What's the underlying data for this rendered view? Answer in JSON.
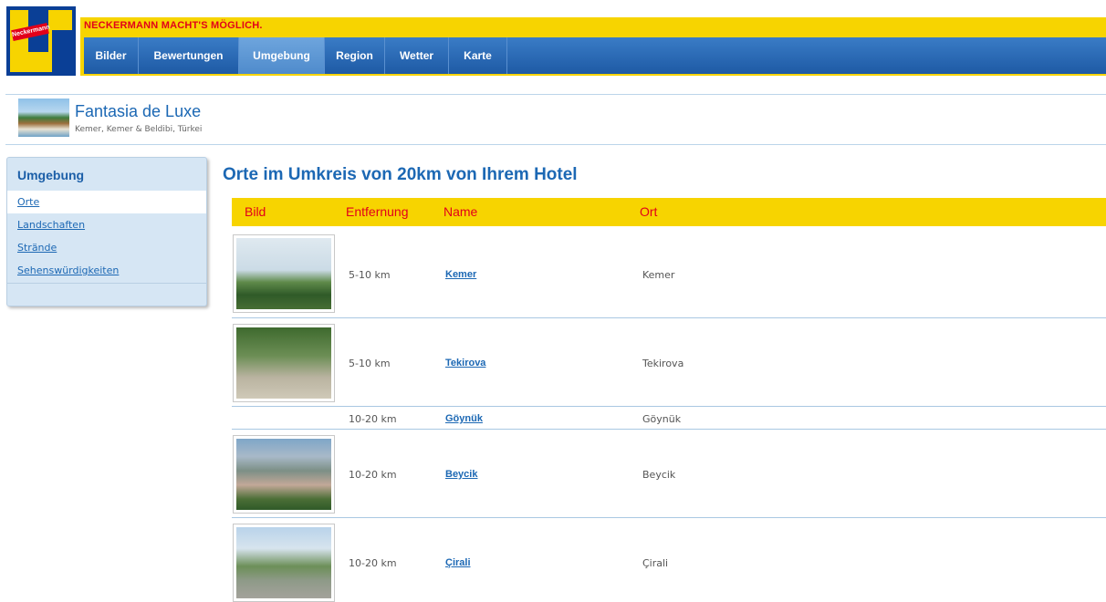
{
  "brand": {
    "logo_text": "Neckermann",
    "slogan": "NECKERMANN MACHT'S MÖGLICH.",
    "colors": {
      "yellow": "#f7d400",
      "blue": "#1e5aa5",
      "red": "#e2001a"
    }
  },
  "nav": {
    "items": [
      {
        "label": "Bilder",
        "active": false
      },
      {
        "label": "Bewertungen",
        "active": false
      },
      {
        "label": "Umgebung",
        "active": true
      },
      {
        "label": "Region",
        "active": false
      },
      {
        "label": "Wetter",
        "active": false
      },
      {
        "label": "Karte",
        "active": false
      }
    ]
  },
  "hotel": {
    "name": "Fantasia de Luxe",
    "location": "Kemer, Kemer & Beldibi, Türkei"
  },
  "sidebar": {
    "title": "Umgebung",
    "items": [
      {
        "label": "Orte",
        "active": true
      },
      {
        "label": "Landschaften",
        "active": false
      },
      {
        "label": "Strände",
        "active": false
      },
      {
        "label": "Sehenswürdigkeiten",
        "active": false
      }
    ]
  },
  "main": {
    "title": "Orte im Umkreis von 20km von Ihrem Hotel",
    "columns": [
      "Bild",
      "Entfernung",
      "Name",
      "Ort"
    ],
    "rows": [
      {
        "has_image": true,
        "image_icon": "minaret-photo",
        "distance": "5-10 km",
        "name": "Kemer",
        "ort": "Kemer"
      },
      {
        "has_image": true,
        "image_icon": "forest-path-photo",
        "distance": "5-10 km",
        "name": "Tekirova",
        "ort": "Tekirova"
      },
      {
        "has_image": false,
        "distance": "10-20 km",
        "name": "Göynük",
        "ort": "Göynük"
      },
      {
        "has_image": true,
        "image_icon": "mountain-photo",
        "distance": "10-20 km",
        "name": "Beycik",
        "ort": "Beycik"
      },
      {
        "has_image": true,
        "image_icon": "road-photo",
        "distance": "10-20 km",
        "name": "Çirali",
        "ort": "Çirali"
      }
    ]
  }
}
